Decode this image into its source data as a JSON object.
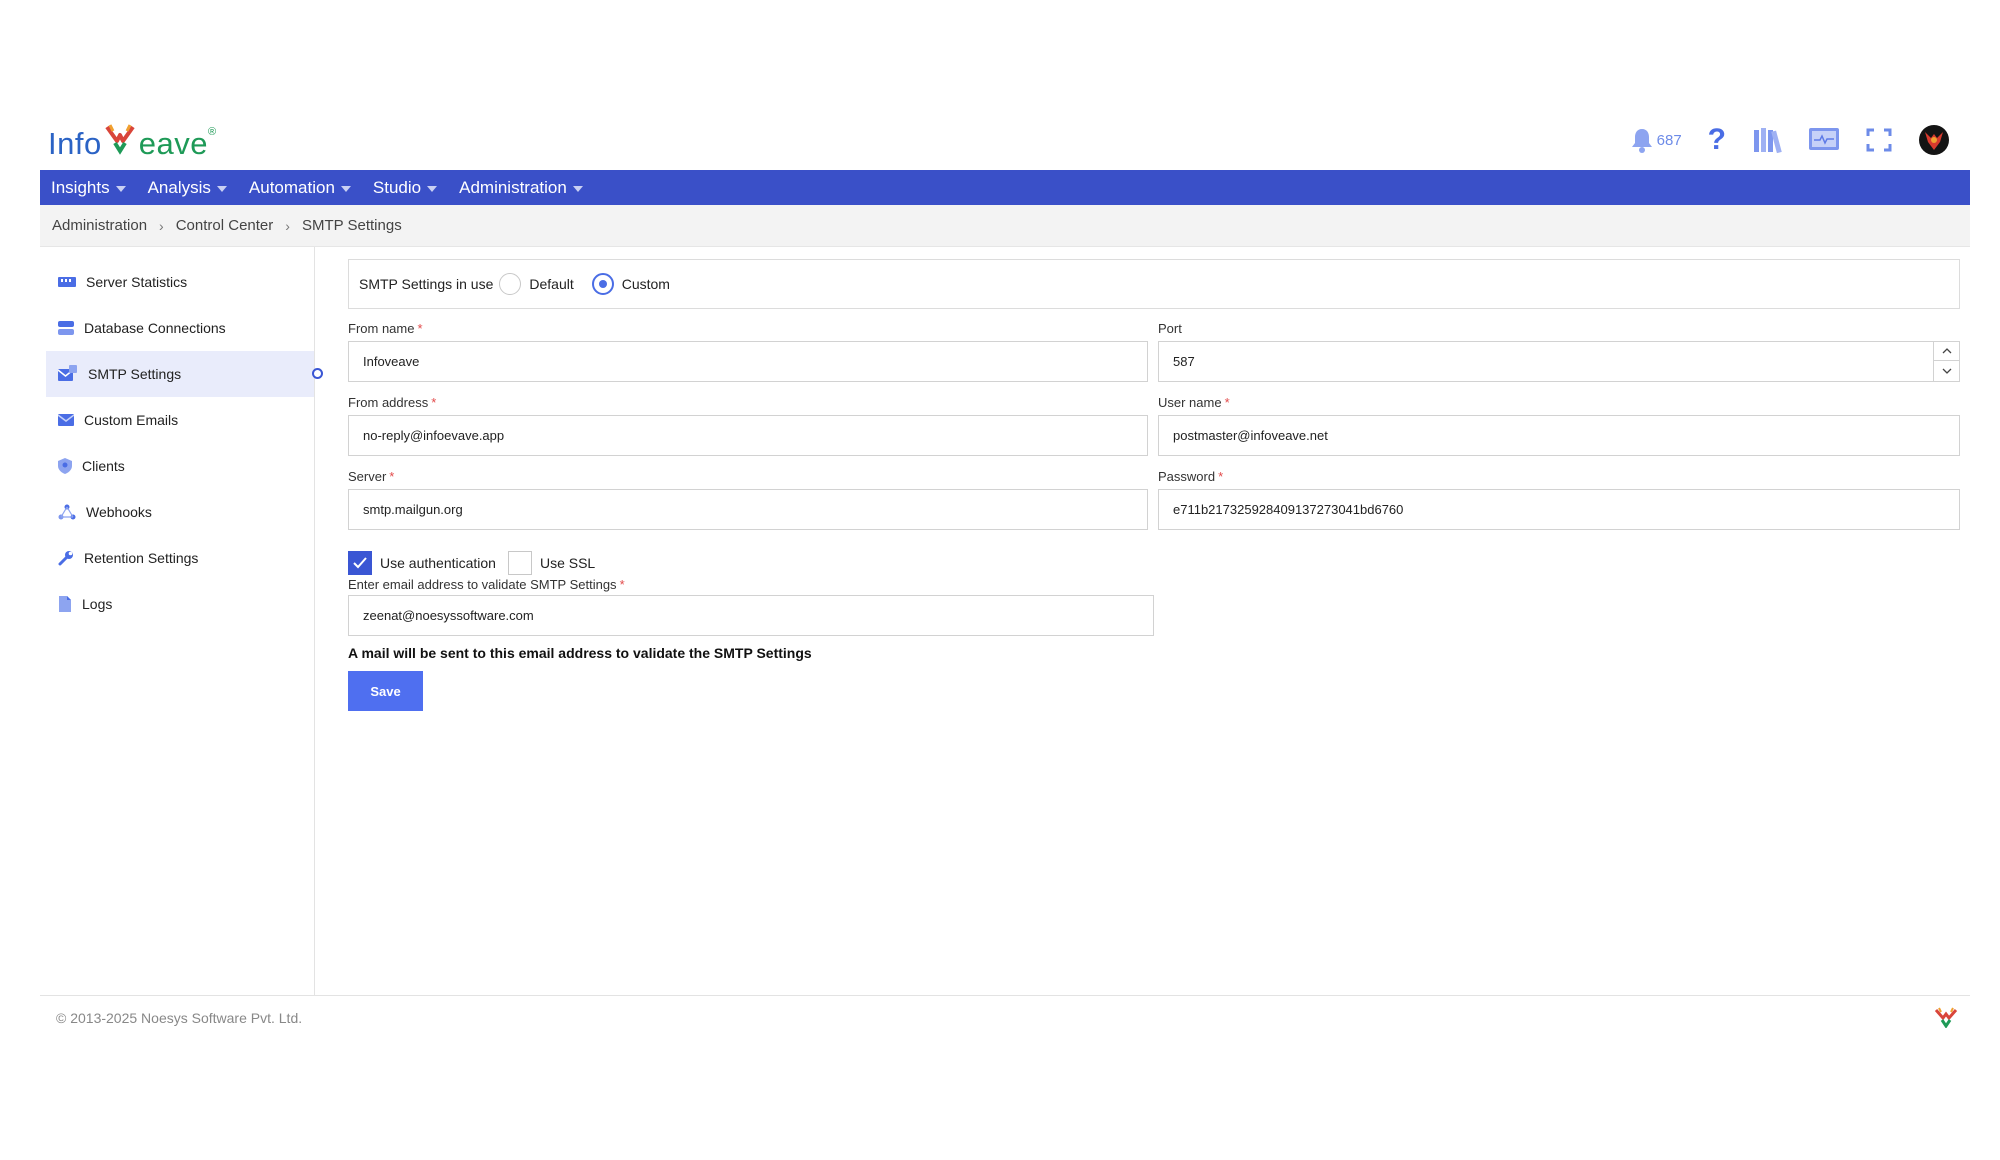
{
  "brand": {
    "part1": "Info",
    "part2": "eave",
    "tm": "®"
  },
  "header": {
    "notification_count": "687"
  },
  "nav": [
    {
      "label": "Insights"
    },
    {
      "label": "Analysis"
    },
    {
      "label": "Automation"
    },
    {
      "label": "Studio"
    },
    {
      "label": "Administration"
    }
  ],
  "breadcrumb": [
    "Administration",
    "Control Center",
    "SMTP Settings"
  ],
  "sidebar": [
    {
      "label": "Server Statistics",
      "icon": "server-statistics-icon"
    },
    {
      "label": "Database Connections",
      "icon": "database-icon"
    },
    {
      "label": "SMTP Settings",
      "icon": "smtp-icon",
      "active": true
    },
    {
      "label": "Custom Emails",
      "icon": "envelope-icon"
    },
    {
      "label": "Clients",
      "icon": "shield-icon"
    },
    {
      "label": "Webhooks",
      "icon": "webhook-icon"
    },
    {
      "label": "Retention Settings",
      "icon": "wrench-icon"
    },
    {
      "label": "Logs",
      "icon": "document-icon"
    }
  ],
  "smtp_mode": {
    "label": "SMTP Settings in use",
    "options": [
      "Default",
      "Custom"
    ],
    "selected": "Custom"
  },
  "form": {
    "from_name": {
      "label": "From name",
      "value": "Infoveave"
    },
    "port": {
      "label": "Port",
      "value": "587"
    },
    "from_address": {
      "label": "From address",
      "value": "no-reply@infoevave.app"
    },
    "user_name": {
      "label": "User name",
      "value": "postmaster@infoveave.net"
    },
    "server": {
      "label": "Server",
      "value": "smtp.mailgun.org"
    },
    "password": {
      "label": "Password",
      "value": "e711b21732592840913727304​1bd6760"
    },
    "use_auth": {
      "label": "Use authentication",
      "checked": true
    },
    "use_ssl": {
      "label": "Use SSL",
      "checked": false
    },
    "validate_email": {
      "label": "Enter email address to validate SMTP Settings",
      "value": "zeenat@noesyssoftware.com"
    },
    "required_mark": "*"
  },
  "note": "A mail will be sent to this email address to validate the SMTP Settings",
  "save_label": "Save",
  "footer": {
    "copyright": "© 2013-2025 Noesys Software Pvt. Ltd."
  },
  "colors": {
    "nav": "#3a50c8",
    "accent": "#4a6de5",
    "button": "#4f6ff0"
  }
}
